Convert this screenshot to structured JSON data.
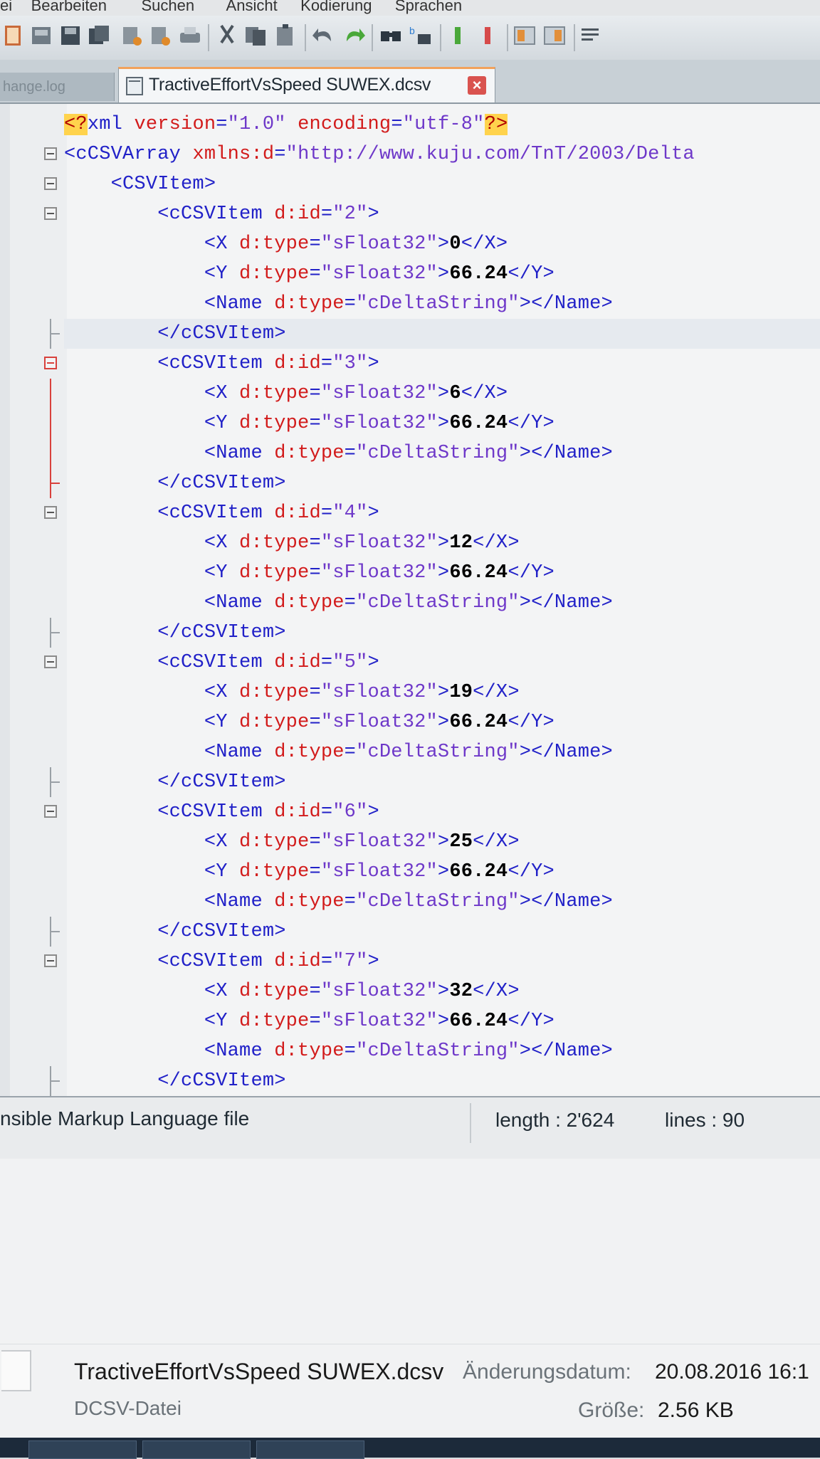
{
  "menu": [
    "ei",
    "Bearbeiten",
    "Suchen",
    "Ansicht",
    "Kodierung",
    "Sprachen"
  ],
  "tabs": [
    {
      "label": "hange.log",
      "active": false
    },
    {
      "label": "TractiveEffortVsSpeed SUWEX.dcsv",
      "active": true
    }
  ],
  "toolbar_icons": [
    "new-file-icon",
    "open-file-icon",
    "save-icon",
    "save-all-icon",
    "close-icon",
    "close-all-icon",
    "print-icon",
    "cut-icon",
    "copy-icon",
    "paste-icon",
    "undo-icon",
    "redo-icon",
    "find-icon",
    "replace-icon",
    "zoom-in-icon",
    "zoom-out-icon",
    "sync-v-icon",
    "sync-h-icon",
    "wrap-icon"
  ],
  "code_lines": [
    [
      [
        "pi",
        "<?"
      ],
      [
        "tag",
        "xml "
      ],
      [
        "attr",
        "version"
      ],
      [
        "eq",
        "="
      ],
      [
        "str",
        "\"1.0\" "
      ],
      [
        "attr",
        "encoding"
      ],
      [
        "eq",
        "="
      ],
      [
        "str",
        "\"utf-8\""
      ],
      [
        "pi",
        "?>"
      ]
    ],
    [
      [
        "tag",
        "<cCSVArray "
      ],
      [
        "attr",
        "xmlns:d"
      ],
      [
        "eq",
        "="
      ],
      [
        "str",
        "\"http://www.kuju.com/TnT/2003/Delta"
      ]
    ],
    [
      [
        "tag",
        "    <CSVItem>"
      ]
    ],
    [
      [
        "tag",
        "        <cCSVItem "
      ],
      [
        "attr",
        "d:id"
      ],
      [
        "eq",
        "="
      ],
      [
        "str",
        "\"2\""
      ],
      [
        "tag",
        ">"
      ]
    ],
    [
      [
        "tag",
        "            <X "
      ],
      [
        "attr",
        "d:type"
      ],
      [
        "eq",
        "="
      ],
      [
        "str",
        "\"sFloat32\""
      ],
      [
        "tag",
        ">"
      ],
      [
        "txt",
        "0"
      ],
      [
        "tag",
        "</X>"
      ]
    ],
    [
      [
        "tag",
        "            <Y "
      ],
      [
        "attr",
        "d:type"
      ],
      [
        "eq",
        "="
      ],
      [
        "str",
        "\"sFloat32\""
      ],
      [
        "tag",
        ">"
      ],
      [
        "txt",
        "66.24"
      ],
      [
        "tag",
        "</Y>"
      ]
    ],
    [
      [
        "tag",
        "            <Name "
      ],
      [
        "attr",
        "d:type"
      ],
      [
        "eq",
        "="
      ],
      [
        "str",
        "\"cDeltaString\""
      ],
      [
        "tag",
        "></Name>"
      ]
    ],
    [
      [
        "tag",
        "        </cCSVItem>"
      ]
    ],
    [
      [
        "tag",
        "        <cCSVItem "
      ],
      [
        "attr",
        "d:id"
      ],
      [
        "eq",
        "="
      ],
      [
        "str",
        "\"3\""
      ],
      [
        "tag",
        ">"
      ]
    ],
    [
      [
        "tag",
        "            <X "
      ],
      [
        "attr",
        "d:type"
      ],
      [
        "eq",
        "="
      ],
      [
        "str",
        "\"sFloat32\""
      ],
      [
        "tag",
        ">"
      ],
      [
        "txt",
        "6"
      ],
      [
        "tag",
        "</X>"
      ]
    ],
    [
      [
        "tag",
        "            <Y "
      ],
      [
        "attr",
        "d:type"
      ],
      [
        "eq",
        "="
      ],
      [
        "str",
        "\"sFloat32\""
      ],
      [
        "tag",
        ">"
      ],
      [
        "txt",
        "66.24"
      ],
      [
        "tag",
        "</Y>"
      ]
    ],
    [
      [
        "tag",
        "            <Name "
      ],
      [
        "attr",
        "d:type"
      ],
      [
        "eq",
        "="
      ],
      [
        "str",
        "\"cDeltaString\""
      ],
      [
        "tag",
        "></Name>"
      ]
    ],
    [
      [
        "tag",
        "        </cCSVItem>"
      ]
    ],
    [
      [
        "tag",
        "        <cCSVItem "
      ],
      [
        "attr",
        "d:id"
      ],
      [
        "eq",
        "="
      ],
      [
        "str",
        "\"4\""
      ],
      [
        "tag",
        ">"
      ]
    ],
    [
      [
        "tag",
        "            <X "
      ],
      [
        "attr",
        "d:type"
      ],
      [
        "eq",
        "="
      ],
      [
        "str",
        "\"sFloat32\""
      ],
      [
        "tag",
        ">"
      ],
      [
        "txt",
        "12"
      ],
      [
        "tag",
        "</X>"
      ]
    ],
    [
      [
        "tag",
        "            <Y "
      ],
      [
        "attr",
        "d:type"
      ],
      [
        "eq",
        "="
      ],
      [
        "str",
        "\"sFloat32\""
      ],
      [
        "tag",
        ">"
      ],
      [
        "txt",
        "66.24"
      ],
      [
        "tag",
        "</Y>"
      ]
    ],
    [
      [
        "tag",
        "            <Name "
      ],
      [
        "attr",
        "d:type"
      ],
      [
        "eq",
        "="
      ],
      [
        "str",
        "\"cDeltaString\""
      ],
      [
        "tag",
        "></Name>"
      ]
    ],
    [
      [
        "tag",
        "        </cCSVItem>"
      ]
    ],
    [
      [
        "tag",
        "        <cCSVItem "
      ],
      [
        "attr",
        "d:id"
      ],
      [
        "eq",
        "="
      ],
      [
        "str",
        "\"5\""
      ],
      [
        "tag",
        ">"
      ]
    ],
    [
      [
        "tag",
        "            <X "
      ],
      [
        "attr",
        "d:type"
      ],
      [
        "eq",
        "="
      ],
      [
        "str",
        "\"sFloat32\""
      ],
      [
        "tag",
        ">"
      ],
      [
        "txt",
        "19"
      ],
      [
        "tag",
        "</X>"
      ]
    ],
    [
      [
        "tag",
        "            <Y "
      ],
      [
        "attr",
        "d:type"
      ],
      [
        "eq",
        "="
      ],
      [
        "str",
        "\"sFloat32\""
      ],
      [
        "tag",
        ">"
      ],
      [
        "txt",
        "66.24"
      ],
      [
        "tag",
        "</Y>"
      ]
    ],
    [
      [
        "tag",
        "            <Name "
      ],
      [
        "attr",
        "d:type"
      ],
      [
        "eq",
        "="
      ],
      [
        "str",
        "\"cDeltaString\""
      ],
      [
        "tag",
        "></Name>"
      ]
    ],
    [
      [
        "tag",
        "        </cCSVItem>"
      ]
    ],
    [
      [
        "tag",
        "        <cCSVItem "
      ],
      [
        "attr",
        "d:id"
      ],
      [
        "eq",
        "="
      ],
      [
        "str",
        "\"6\""
      ],
      [
        "tag",
        ">"
      ]
    ],
    [
      [
        "tag",
        "            <X "
      ],
      [
        "attr",
        "d:type"
      ],
      [
        "eq",
        "="
      ],
      [
        "str",
        "\"sFloat32\""
      ],
      [
        "tag",
        ">"
      ],
      [
        "txt",
        "25"
      ],
      [
        "tag",
        "</X>"
      ]
    ],
    [
      [
        "tag",
        "            <Y "
      ],
      [
        "attr",
        "d:type"
      ],
      [
        "eq",
        "="
      ],
      [
        "str",
        "\"sFloat32\""
      ],
      [
        "tag",
        ">"
      ],
      [
        "txt",
        "66.24"
      ],
      [
        "tag",
        "</Y>"
      ]
    ],
    [
      [
        "tag",
        "            <Name "
      ],
      [
        "attr",
        "d:type"
      ],
      [
        "eq",
        "="
      ],
      [
        "str",
        "\"cDeltaString\""
      ],
      [
        "tag",
        "></Name>"
      ]
    ],
    [
      [
        "tag",
        "        </cCSVItem>"
      ]
    ],
    [
      [
        "tag",
        "        <cCSVItem "
      ],
      [
        "attr",
        "d:id"
      ],
      [
        "eq",
        "="
      ],
      [
        "str",
        "\"7\""
      ],
      [
        "tag",
        ">"
      ]
    ],
    [
      [
        "tag",
        "            <X "
      ],
      [
        "attr",
        "d:type"
      ],
      [
        "eq",
        "="
      ],
      [
        "str",
        "\"sFloat32\""
      ],
      [
        "tag",
        ">"
      ],
      [
        "txt",
        "32"
      ],
      [
        "tag",
        "</X>"
      ]
    ],
    [
      [
        "tag",
        "            <Y "
      ],
      [
        "attr",
        "d:type"
      ],
      [
        "eq",
        "="
      ],
      [
        "str",
        "\"sFloat32\""
      ],
      [
        "tag",
        ">"
      ],
      [
        "txt",
        "66.24"
      ],
      [
        "tag",
        "</Y>"
      ]
    ],
    [
      [
        "tag",
        "            <Name "
      ],
      [
        "attr",
        "d:type"
      ],
      [
        "eq",
        "="
      ],
      [
        "str",
        "\"cDeltaString\""
      ],
      [
        "tag",
        "></Name>"
      ]
    ],
    [
      [
        "tag",
        "        </cCSVItem>"
      ]
    ]
  ],
  "fold_markers": {
    "1": "box",
    "2": "box",
    "3": "box",
    "7": "end",
    "8": "box-red",
    "9": "line-red",
    "10": "line-red",
    "11": "line-red",
    "12": "end-red",
    "13": "box",
    "17": "end",
    "18": "box",
    "22": "end",
    "23": "box",
    "27": "end",
    "28": "box",
    "32": "end"
  },
  "current_line": 8,
  "statusbar": {
    "file_type": "nsible Markup Language file",
    "length": "length : 2'624",
    "lines": "lines : 90"
  },
  "details": {
    "file_name": "TractiveEffortVsSpeed SUWEX.dcsv",
    "date_label": "Änderungsdatum:",
    "date_value": "20.08.2016 16:1",
    "file_type": "DCSV-Datei",
    "size_label": "Größe:",
    "size_value": "2.56 KB"
  },
  "colors": {
    "tag": "#2121c8",
    "attr": "#d21b1b",
    "string": "#6e38c9",
    "pi_bg": "#ffd34d",
    "active_tab_accent": "#f2a25c"
  }
}
